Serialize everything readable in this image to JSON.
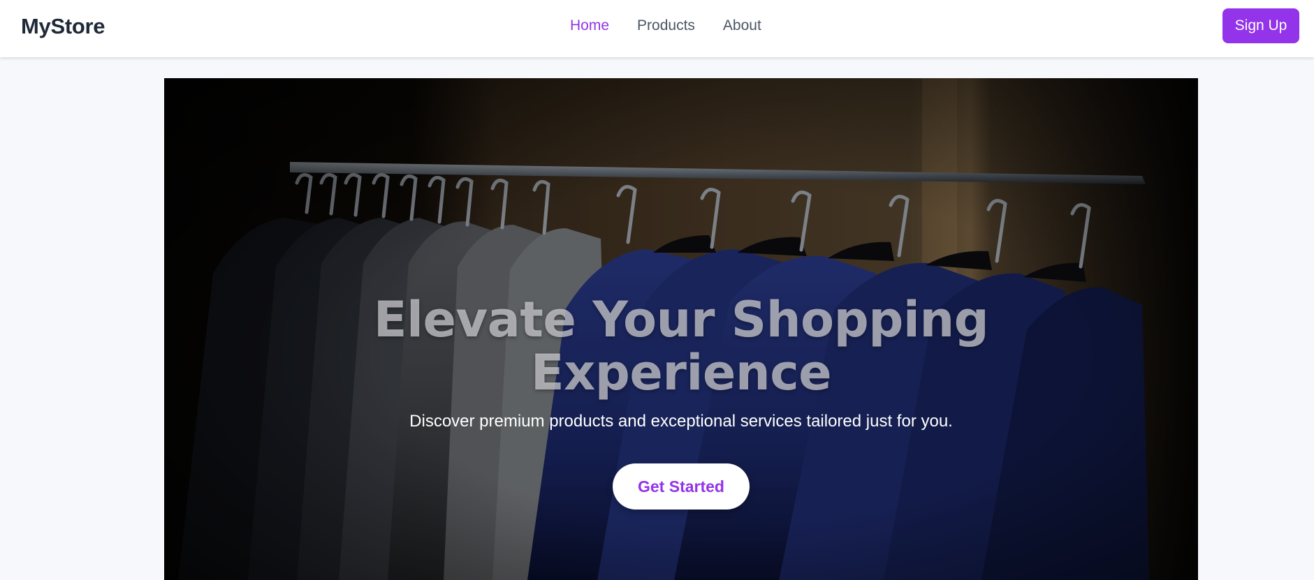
{
  "brand": {
    "name": "MyStore"
  },
  "nav": {
    "items": [
      {
        "label": "Home",
        "active": true
      },
      {
        "label": "Products",
        "active": false
      },
      {
        "label": "About",
        "active": false
      }
    ]
  },
  "header": {
    "signup_label": "Sign Up"
  },
  "hero": {
    "title_line1": "Elevate Your Shopping",
    "title_line2": "Experience",
    "subtitle": "Discover premium products and exceptional services tailored just for you.",
    "cta_label": "Get Started",
    "image_subject": "rack of suit jackets on hangers"
  },
  "colors": {
    "accent": "#9333ea",
    "nav_text": "#4b5563",
    "brand_text": "#1f2937",
    "page_bg": "#f7f8fb"
  }
}
